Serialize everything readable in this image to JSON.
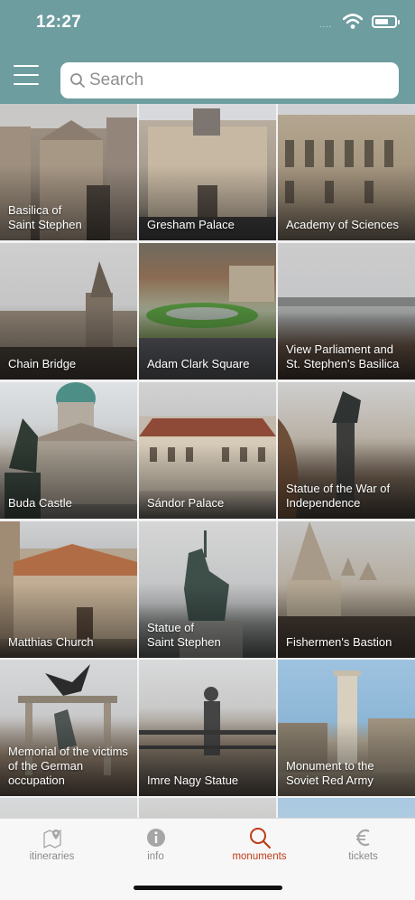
{
  "status": {
    "time": "12:27",
    "signal": "....",
    "colors": {
      "bar": "#6e9da0"
    }
  },
  "header": {
    "search_placeholder": "Search",
    "menu_icon": "hamburger-menu-icon",
    "search_icon": "magnifier-icon"
  },
  "monuments": [
    {
      "label": "Basilica of\nSaint Stephen"
    },
    {
      "label": "Gresham Palace"
    },
    {
      "label": "Academy of Sciences"
    },
    {
      "label": "Chain Bridge"
    },
    {
      "label": "Adam Clark Square"
    },
    {
      "label": "View Parliament and\nSt. Stephen's Basilica"
    },
    {
      "label": "Buda Castle"
    },
    {
      "label": "Sándor Palace"
    },
    {
      "label": "Statue of the War of\nIndependence"
    },
    {
      "label": "Matthias Church"
    },
    {
      "label": "Statue of\nSaint Stephen"
    },
    {
      "label": "Fishermen's Bastion"
    },
    {
      "label": "Memorial of the victims\nof the German\noccupation"
    },
    {
      "label": "Imre Nagy Statue"
    },
    {
      "label": "Monument to the\nSoviet Red Army"
    },
    {
      "label": ""
    },
    {
      "label": ""
    },
    {
      "label": ""
    }
  ],
  "tabs": [
    {
      "label": "itineraries",
      "icon": "map-pin-icon"
    },
    {
      "label": "info",
      "icon": "info-icon"
    },
    {
      "label": "monuments",
      "icon": "search-icon"
    },
    {
      "label": "tickets",
      "icon": "euro-icon"
    }
  ],
  "active_tab": "monuments",
  "colors": {
    "accent": "#c03a17",
    "header": "#6e9da0",
    "tab_inactive": "#8a8a8a"
  }
}
